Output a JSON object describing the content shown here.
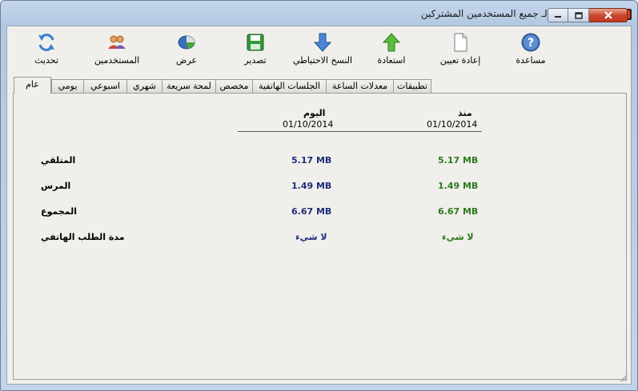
{
  "window": {
    "title": "تقرير الإستخدام لـ جميع المستخدمين المشتركين"
  },
  "toolbar": {
    "help": "مساعدة",
    "reset": "إعادة تعيين",
    "restore": "استعادة",
    "backup": "النسخ الاحتياطي",
    "export": "تصدير",
    "view": "عرض",
    "users": "المستخدمين",
    "refresh": "تحديث"
  },
  "tabs": [
    "تطبيقات",
    "معدلات الساعة",
    "الجلسات الهاتفية",
    "مخصص",
    "لمحة سريعة",
    "شهري",
    "اسبوعي",
    "يومي",
    "عام"
  ],
  "active_tab": "عام",
  "report": {
    "col_since": {
      "header": "منذ",
      "date": "01/10/2014"
    },
    "col_today": {
      "header": "اليوم",
      "date": "01/10/2014"
    },
    "rows": [
      {
        "label": "المتلقي",
        "since": "5.17 MB",
        "today": "5.17 MB"
      },
      {
        "label": "المرس",
        "since": "1.49 MB",
        "today": "1.49 MB"
      },
      {
        "label": "المجموع",
        "since": "6.67 MB",
        "today": "6.67 MB"
      },
      {
        "label": "مدة الطلب الهاتفي",
        "since": "لا شيء",
        "today": "لا شيء"
      }
    ]
  },
  "colors": {
    "today_value": "#1d2d7a",
    "since_value": "#2c7a1e",
    "accent": "#c9442b"
  }
}
